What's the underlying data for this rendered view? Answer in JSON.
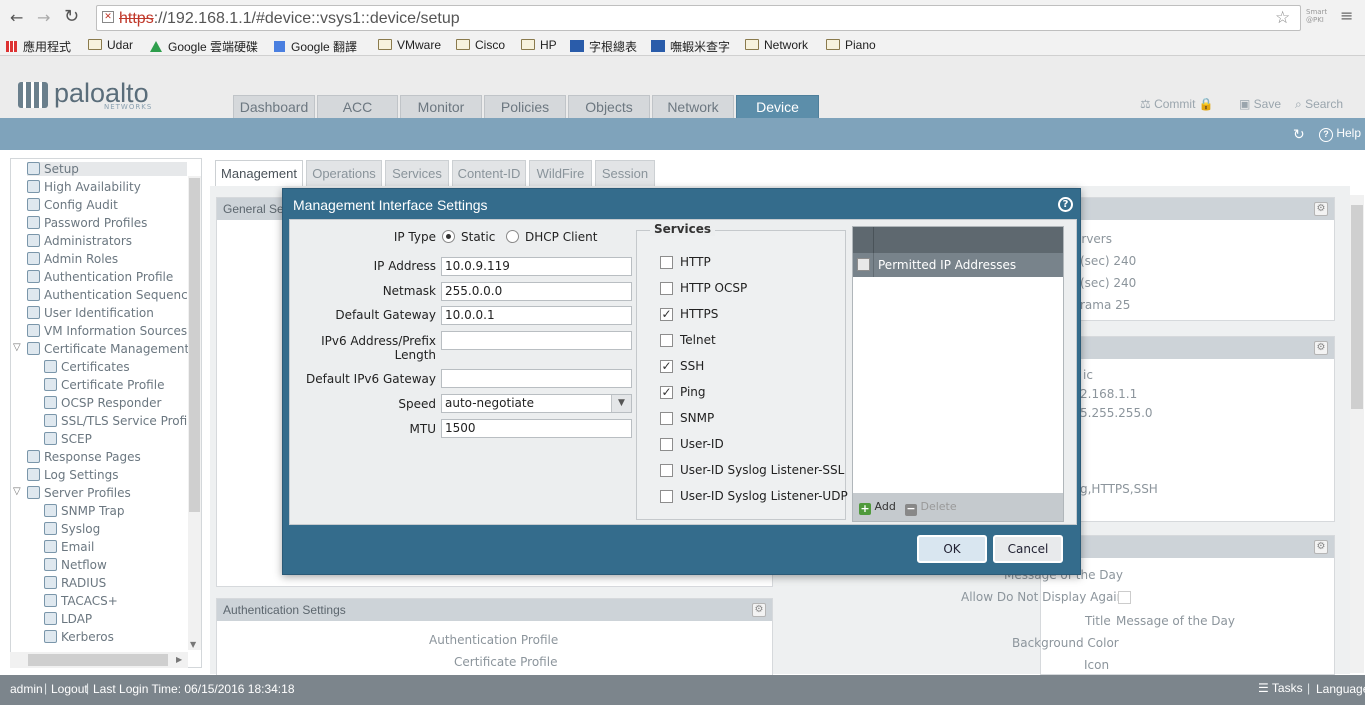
{
  "browser": {
    "url_protocol": "https",
    "url_rest": "://192.168.1.1/#device::vsys1::device/setup",
    "bookmarks": [
      "應用程式",
      "Udar",
      "Google 雲端硬碟",
      "Google 翻譯",
      "VMware",
      "Cisco",
      "HP",
      "字根總表",
      "嘸蝦米查字",
      "Network",
      "Piano"
    ]
  },
  "header": {
    "logo": "paloalto",
    "logo_sub": "NETWORKS",
    "tabs": [
      "Dashboard",
      "ACC",
      "Monitor",
      "Policies",
      "Objects",
      "Network",
      "Device"
    ],
    "active_tab": "Device",
    "commit": "Commit",
    "save": "Save",
    "search": "Search",
    "help": "Help"
  },
  "tree": {
    "items": [
      {
        "label": "Setup",
        "indent": 0
      },
      {
        "label": "High Availability",
        "indent": 0
      },
      {
        "label": "Config Audit",
        "indent": 0
      },
      {
        "label": "Password Profiles",
        "indent": 0
      },
      {
        "label": "Administrators",
        "indent": 0
      },
      {
        "label": "Admin Roles",
        "indent": 0
      },
      {
        "label": "Authentication Profile",
        "indent": 0
      },
      {
        "label": "Authentication Sequence",
        "indent": 0
      },
      {
        "label": "User Identification",
        "indent": 0
      },
      {
        "label": "VM Information Sources",
        "indent": 0
      },
      {
        "label": "Certificate Management",
        "indent": 0
      },
      {
        "label": "Certificates",
        "indent": 1
      },
      {
        "label": "Certificate Profile",
        "indent": 1
      },
      {
        "label": "OCSP Responder",
        "indent": 1
      },
      {
        "label": "SSL/TLS Service Profile",
        "indent": 1
      },
      {
        "label": "SCEP",
        "indent": 1
      },
      {
        "label": "Response Pages",
        "indent": 0
      },
      {
        "label": "Log Settings",
        "indent": 0
      },
      {
        "label": "Server Profiles",
        "indent": 0
      },
      {
        "label": "SNMP Trap",
        "indent": 1
      },
      {
        "label": "Syslog",
        "indent": 1
      },
      {
        "label": "Email",
        "indent": 1
      },
      {
        "label": "Netflow",
        "indent": 1
      },
      {
        "label": "RADIUS",
        "indent": 1
      },
      {
        "label": "TACACS+",
        "indent": 1
      },
      {
        "label": "LDAP",
        "indent": 1
      },
      {
        "label": "Kerberos",
        "indent": 1
      }
    ]
  },
  "subtabs": [
    "Management",
    "Operations",
    "Services",
    "Content-ID",
    "WildFire",
    "Session"
  ],
  "background": {
    "general_settings": "General Settings",
    "servers_fragment": "ervers",
    "sec1": "(sec)  240",
    "sec2": "(sec)  240",
    "rama": "rama  25",
    "static_fragment": "ic",
    "ip_fragment": "2.168.1.1",
    "mask_fragment": "5.255.255.0",
    "services_fragment": "g,HTTPS,SSH",
    "auth_settings": "Authentication Settings",
    "auth_profile": "Authentication Profile",
    "cert_profile": "Certificate Profile",
    "message_of_day_label": "Message of the Day",
    "allow_dont_display": "Allow Do Not Display Again",
    "title_label": "Title",
    "title_value": "Message of the Day",
    "bg_color": "Background Color",
    "icon": "Icon"
  },
  "dialog": {
    "title": "Management Interface Settings",
    "ip_type_label": "IP Type",
    "ip_type_static": "Static",
    "ip_type_dhcp": "DHCP Client",
    "ip_address_label": "IP Address",
    "ip_address": "10.0.9.119",
    "netmask_label": "Netmask",
    "netmask": "255.0.0.0",
    "gateway_label": "Default Gateway",
    "gateway": "10.0.0.1",
    "ipv6_label_1": "IPv6 Address/Prefix",
    "ipv6_label_2": "Length",
    "ipv6_gw_label": "Default IPv6 Gateway",
    "speed_label": "Speed",
    "speed": "auto-negotiate",
    "mtu_label": "MTU",
    "mtu": "1500",
    "services_title": "Services",
    "services": [
      {
        "name": "HTTP",
        "checked": false
      },
      {
        "name": "HTTP OCSP",
        "checked": false
      },
      {
        "name": "HTTPS",
        "checked": true
      },
      {
        "name": "Telnet",
        "checked": false
      },
      {
        "name": "SSH",
        "checked": true
      },
      {
        "name": "Ping",
        "checked": true
      },
      {
        "name": "SNMP",
        "checked": false
      },
      {
        "name": "User-ID",
        "checked": false
      },
      {
        "name": "User-ID Syslog Listener-SSL",
        "checked": false
      },
      {
        "name": "User-ID Syslog Listener-UDP",
        "checked": false
      }
    ],
    "permitted_header": "Permitted IP Addresses",
    "add": "Add",
    "delete": "Delete",
    "ok": "OK",
    "cancel": "Cancel"
  },
  "status": {
    "user": "admin",
    "logout": "Logout",
    "last_login": "Last Login Time: 06/15/2016 18:34:18",
    "tasks": "Tasks",
    "language": "Language"
  }
}
